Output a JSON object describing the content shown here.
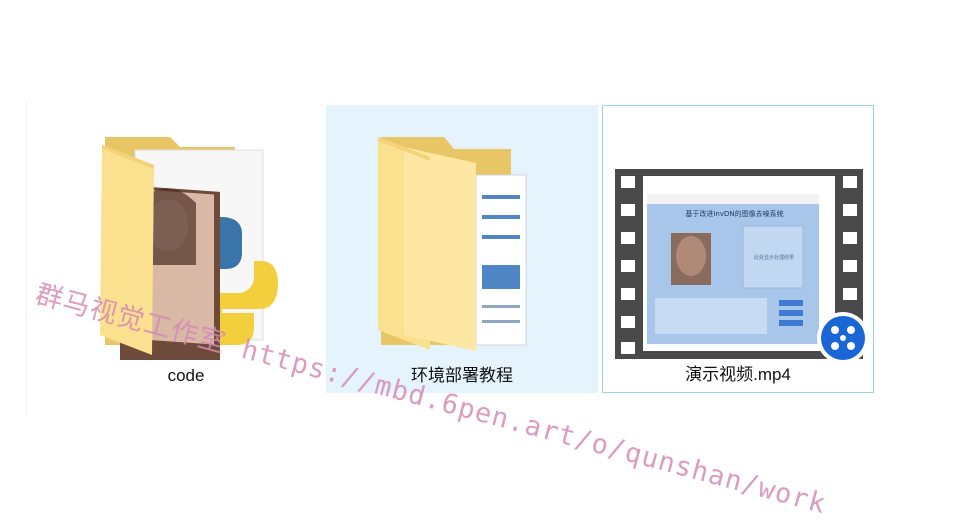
{
  "files": [
    {
      "name": "code",
      "type": "folder-with-preview",
      "state": "normal"
    },
    {
      "name": "环境部署教程",
      "type": "folder",
      "state": "hover"
    },
    {
      "name": "演示视频.mp4",
      "type": "video",
      "state": "selected",
      "preview": {
        "app_title": "基于改进InvDN的图像去噪系统",
        "placeholder": "此处显示处理结果"
      }
    }
  ],
  "watermark": "群马视觉工作室 https://mbd.6pen.art/o/qunshan/work",
  "colors": {
    "hover_bg": "#e5f3fd",
    "selected_border": "#99d1f5",
    "folder_back": "#e8c565",
    "folder_front": "#fbe08f",
    "watermark": "#d68bb5"
  }
}
